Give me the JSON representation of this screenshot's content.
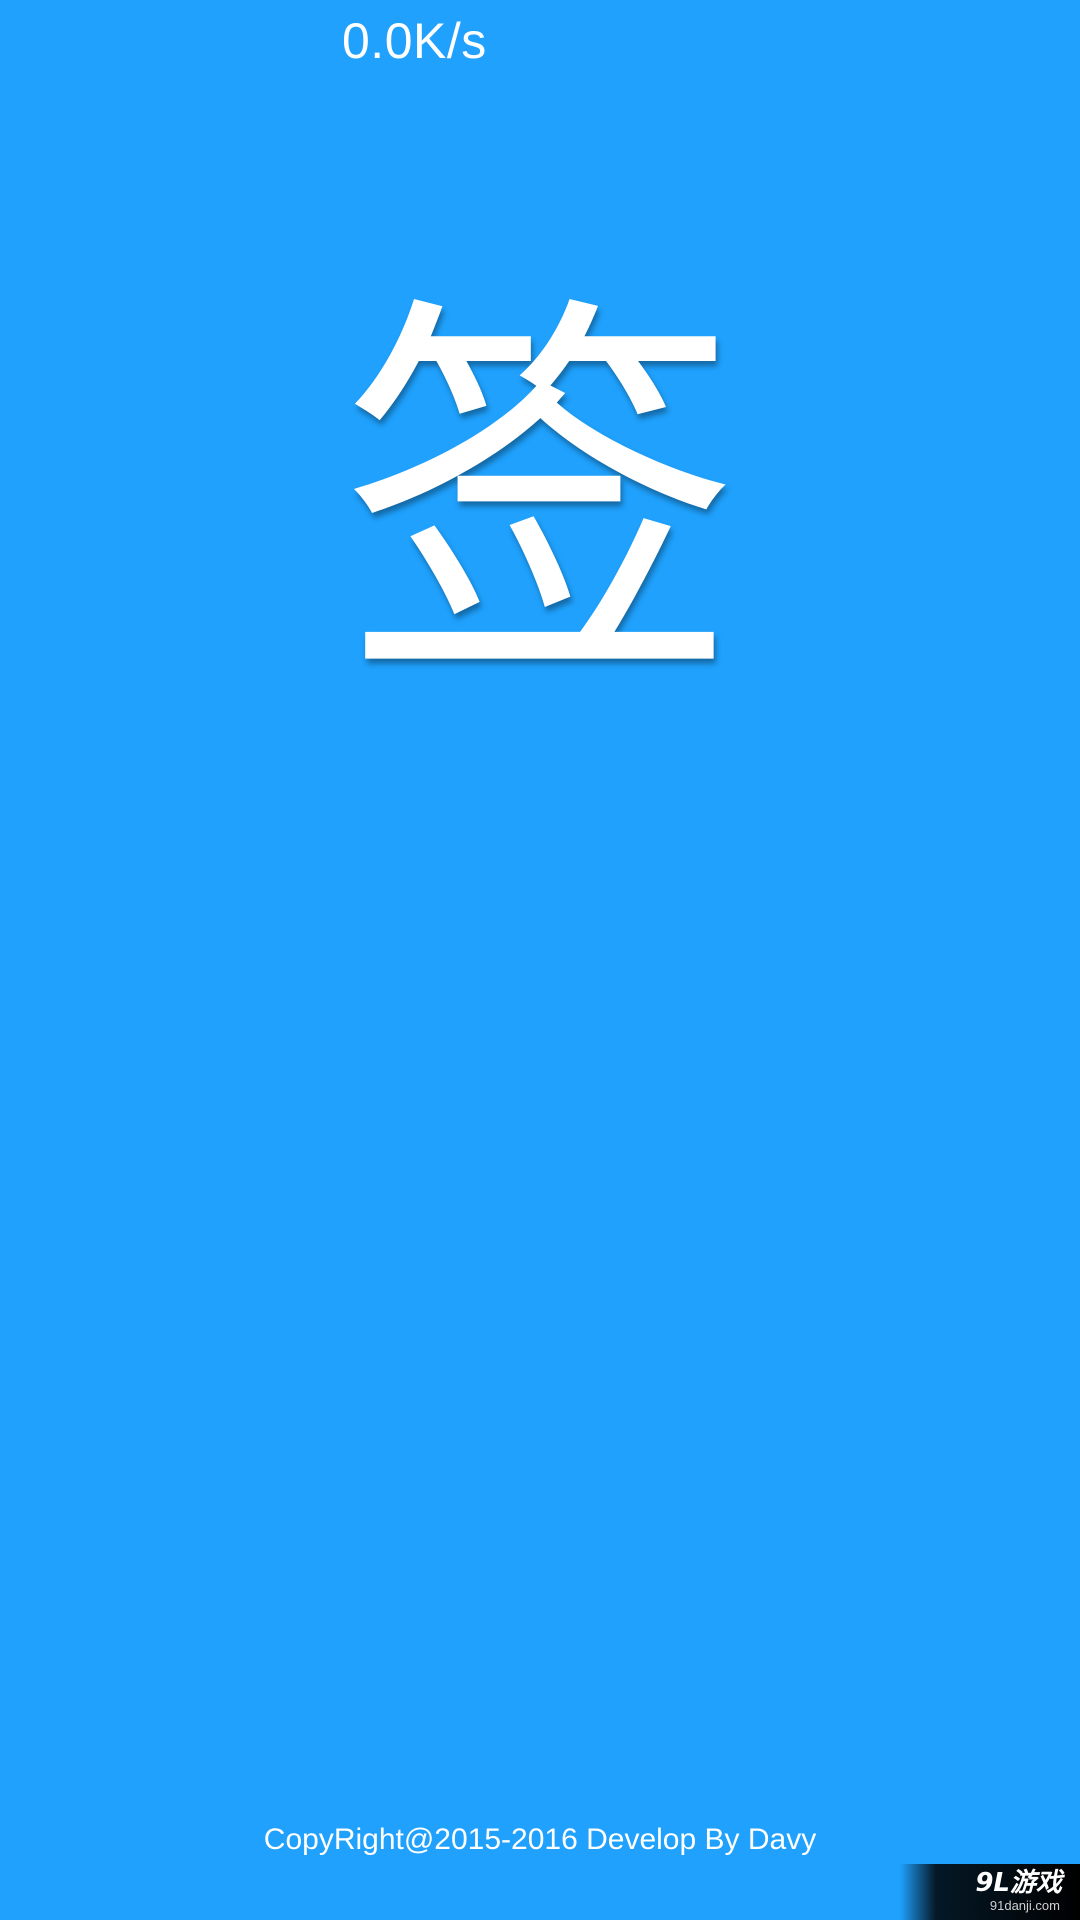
{
  "status_bar": {
    "net_speed": "0.0K/s"
  },
  "logo": {
    "char": "签"
  },
  "footer": {
    "copyright": "CopyRight@2015-2016 Develop By Davy"
  },
  "watermark": {
    "brand": "9L游戏",
    "url": "91danji.com"
  },
  "colors": {
    "background": "#1fa1fd",
    "text": "#ffffff"
  }
}
